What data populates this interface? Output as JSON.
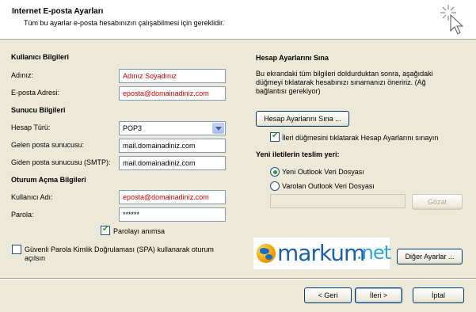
{
  "header": {
    "title": "Internet E-posta Ayarları",
    "subtitle": "Tüm bu ayarlar e-posta hesabınızın çalışabilmesi için gereklidir."
  },
  "user_info": {
    "section_title": "Kullanıcı Bilgileri",
    "name_label": "Adınız:",
    "name_value": "Adınız Soyadınız",
    "email_label": "E-posta Adresi:",
    "email_value": "eposta@domainadiniz.com"
  },
  "server_info": {
    "section_title": "Sunucu Bilgileri",
    "account_type_label": "Hesap Türü:",
    "account_type_value": "POP3",
    "incoming_label": "Gelen posta sunucusu:",
    "incoming_value": "mail.domainadiniz.com",
    "outgoing_label": "Giden posta sunucusu (SMTP):",
    "outgoing_value": "mail.domainadiniz.com"
  },
  "logon_info": {
    "section_title": "Oturum Açma Bilgileri",
    "username_label": "Kullanıcı Adı:",
    "username_value": "eposta@domainadiniz.com",
    "password_label": "Parola:",
    "password_value": "******",
    "remember_label": "Parolayı anımsa",
    "remember_checked": true,
    "spa_label_line1": "Güvenli Parola Kimlik Doğrulaması (SPA) kullanarak oturum",
    "spa_label_line2": "açılsın",
    "spa_checked": false
  },
  "test_settings": {
    "section_title": "Hesap Ayarlarını Sına",
    "desc_line1": "Bu ekrandaki tüm bilgileri doldurduktan sonra, aşağıdaki",
    "desc_line2": "düğmeyi tıklatarak hesabınızı sınamanızı öneririz. (Ağ",
    "desc_line3": "bağlantısı gerekiyor)",
    "test_button": "Hesap Ayarlarını Sına ...",
    "auto_test_label": "İleri düğmesini tıklatarak Hesap Ayarlarını sınayın",
    "auto_test_checked": true
  },
  "delivery": {
    "section_title": "Yeni iletilerin teslim yeri:",
    "option_new": "Yeni Outlook Veri Dosyası",
    "option_existing": "Varolan Outlook Veri Dosyası",
    "selected": "new",
    "path_value": "",
    "browse_button": "Gözat"
  },
  "logo": {
    "name": "markum",
    "tld": ".net"
  },
  "more_settings_button": "Diğer Ayarlar ...",
  "footer": {
    "back_button": "< Geri",
    "next_button": "İleri >",
    "cancel_button": "İptal"
  }
}
